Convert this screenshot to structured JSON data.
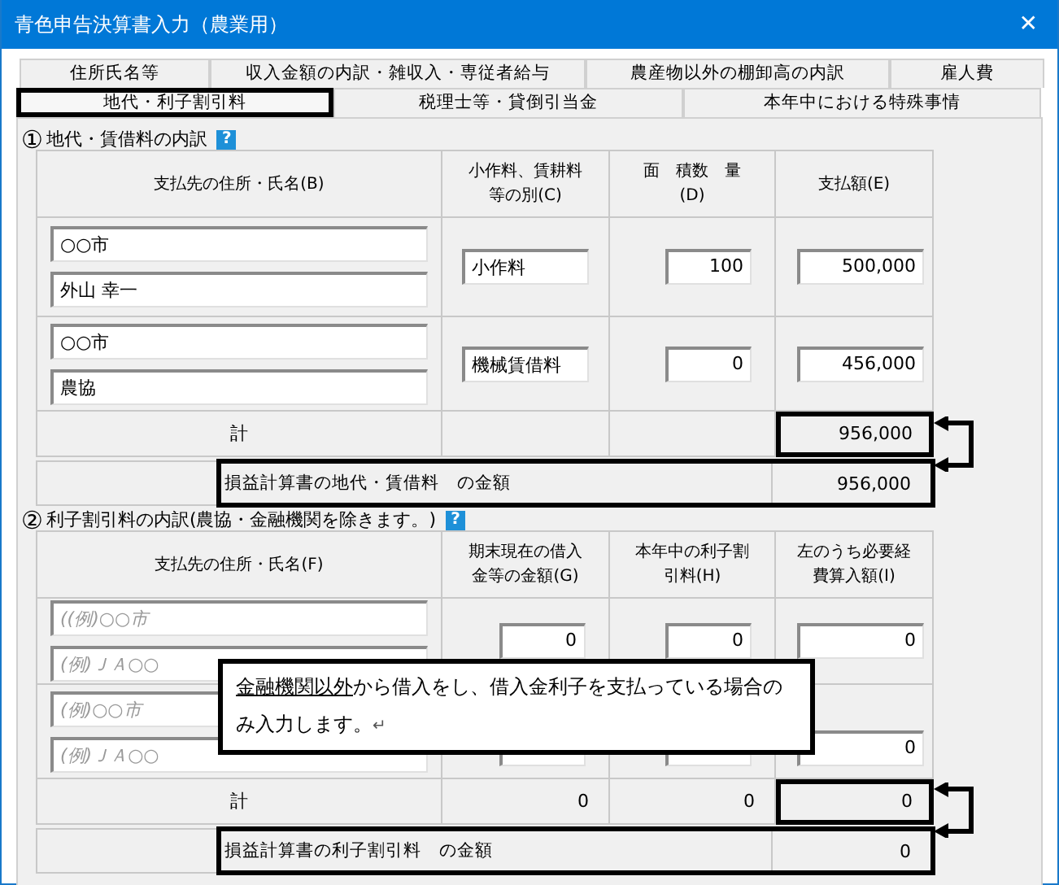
{
  "window": {
    "title": "青色申告決算書入力（農業用）",
    "close": "✕"
  },
  "tab_rows": [
    {
      "tabs": [
        {
          "label": "住所氏名等",
          "selected": false
        },
        {
          "label": "収入金額の内訳・雑収入・専従者給与",
          "selected": false
        },
        {
          "label": "農産物以外の棚卸高の内訳",
          "selected": false
        },
        {
          "label": "雇人費",
          "selected": false
        }
      ]
    },
    {
      "tabs": [
        {
          "label": "地代・利子割引料",
          "selected": true
        },
        {
          "label": "税理士等・貸倒引当金",
          "selected": false
        },
        {
          "label": "本年中における特殊事情",
          "selected": false
        }
      ]
    }
  ],
  "sections": [
    {
      "number": "①",
      "title": "地代・賃借料の内訳",
      "help": "?",
      "columns": [
        "支払先の住所・氏名(B)",
        "小作料、賃耕料等の別(C)",
        "面　積数　量(D)",
        "支払額(E)"
      ],
      "rows": [
        {
          "cells": [
            {
              "kind": "names",
              "fields": [
                {
                  "value": "○○市"
                },
                {
                  "value": "外山 幸一"
                }
              ]
            },
            {
              "kind": "text",
              "value": "小作料"
            },
            {
              "kind": "number",
              "value": "100"
            },
            {
              "kind": "number",
              "value": "500,000"
            }
          ]
        },
        {
          "cells": [
            {
              "kind": "names",
              "fields": [
                {
                  "value": "○○市"
                },
                {
                  "value": "農協"
                }
              ]
            },
            {
              "kind": "text",
              "value": "機械賃借料"
            },
            {
              "kind": "number",
              "value": "0"
            },
            {
              "kind": "number",
              "value": "456,000"
            }
          ]
        }
      ],
      "total": {
        "label": "計",
        "values": [
          {
            "kind": "empty"
          },
          {
            "kind": "empty"
          },
          {
            "kind": "value",
            "value": "956,000",
            "highlighted": true
          }
        ]
      },
      "summary": {
        "label": "損益計算書の地代・賃借料　の金額",
        "value": "956,000",
        "highlighted": true
      }
    },
    {
      "number": "②",
      "title": "利子割引料の内訳(農協・金融機関を除きます。)",
      "help": "?",
      "columns": [
        "支払先の住所・氏名(F)",
        "期末現在の借入金等の金額(G)",
        "本年中の利子割引料(H)",
        "左のうち必要経費算入額(I)"
      ],
      "rows": [
        {
          "cells": [
            {
              "kind": "names",
              "fields": [
                {
                  "placeholder": "((例)○○市"
                },
                {
                  "placeholder": "(例)ＪＡ○○"
                }
              ]
            },
            {
              "kind": "number",
              "value": "0"
            },
            {
              "kind": "number",
              "value": "0"
            },
            {
              "kind": "number",
              "value": "0"
            }
          ]
        },
        {
          "cells": [
            {
              "kind": "names",
              "fields": [
                {
                  "placeholder": "(例)○○市"
                },
                {
                  "placeholder": "(例)ＪＡ○○"
                }
              ]
            },
            {
              "kind": "number"
            },
            {
              "kind": "number"
            },
            {
              "kind": "number",
              "value": "0"
            }
          ]
        }
      ],
      "total": {
        "label": "計",
        "values": [
          {
            "kind": "value",
            "value": "0",
            "highlighted": false
          },
          {
            "kind": "value",
            "value": "0",
            "highlighted": false
          },
          {
            "kind": "value",
            "value": "0",
            "highlighted": true
          }
        ]
      },
      "summary": {
        "label": "損益計算書の利子割引料　の金額",
        "value": "0",
        "highlighted": true
      }
    }
  ],
  "note": {
    "underlined": "金融機関以外",
    "text": "から借入をし、借入金利子を支払っている場合のみ入力します。",
    "mark": "↵"
  }
}
